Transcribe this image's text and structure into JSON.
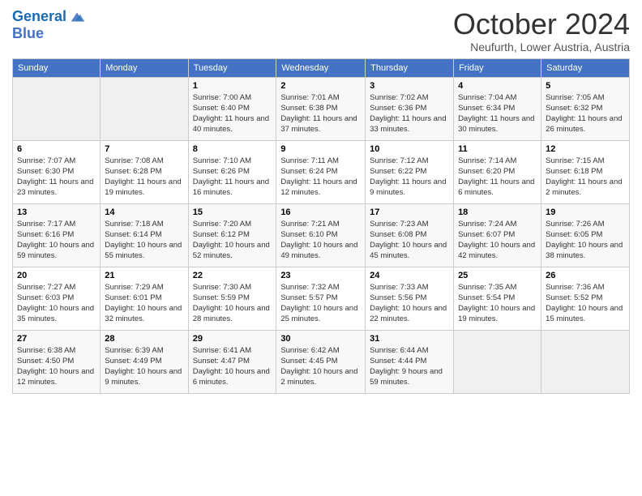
{
  "header": {
    "logo_line1": "General",
    "logo_line2": "Blue",
    "month": "October 2024",
    "location": "Neufurth, Lower Austria, Austria"
  },
  "weekdays": [
    "Sunday",
    "Monday",
    "Tuesday",
    "Wednesday",
    "Thursday",
    "Friday",
    "Saturday"
  ],
  "weeks": [
    [
      {
        "day": "",
        "info": ""
      },
      {
        "day": "",
        "info": ""
      },
      {
        "day": "1",
        "info": "Sunrise: 7:00 AM\nSunset: 6:40 PM\nDaylight: 11 hours and 40 minutes."
      },
      {
        "day": "2",
        "info": "Sunrise: 7:01 AM\nSunset: 6:38 PM\nDaylight: 11 hours and 37 minutes."
      },
      {
        "day": "3",
        "info": "Sunrise: 7:02 AM\nSunset: 6:36 PM\nDaylight: 11 hours and 33 minutes."
      },
      {
        "day": "4",
        "info": "Sunrise: 7:04 AM\nSunset: 6:34 PM\nDaylight: 11 hours and 30 minutes."
      },
      {
        "day": "5",
        "info": "Sunrise: 7:05 AM\nSunset: 6:32 PM\nDaylight: 11 hours and 26 minutes."
      }
    ],
    [
      {
        "day": "6",
        "info": "Sunrise: 7:07 AM\nSunset: 6:30 PM\nDaylight: 11 hours and 23 minutes."
      },
      {
        "day": "7",
        "info": "Sunrise: 7:08 AM\nSunset: 6:28 PM\nDaylight: 11 hours and 19 minutes."
      },
      {
        "day": "8",
        "info": "Sunrise: 7:10 AM\nSunset: 6:26 PM\nDaylight: 11 hours and 16 minutes."
      },
      {
        "day": "9",
        "info": "Sunrise: 7:11 AM\nSunset: 6:24 PM\nDaylight: 11 hours and 12 minutes."
      },
      {
        "day": "10",
        "info": "Sunrise: 7:12 AM\nSunset: 6:22 PM\nDaylight: 11 hours and 9 minutes."
      },
      {
        "day": "11",
        "info": "Sunrise: 7:14 AM\nSunset: 6:20 PM\nDaylight: 11 hours and 6 minutes."
      },
      {
        "day": "12",
        "info": "Sunrise: 7:15 AM\nSunset: 6:18 PM\nDaylight: 11 hours and 2 minutes."
      }
    ],
    [
      {
        "day": "13",
        "info": "Sunrise: 7:17 AM\nSunset: 6:16 PM\nDaylight: 10 hours and 59 minutes."
      },
      {
        "day": "14",
        "info": "Sunrise: 7:18 AM\nSunset: 6:14 PM\nDaylight: 10 hours and 55 minutes."
      },
      {
        "day": "15",
        "info": "Sunrise: 7:20 AM\nSunset: 6:12 PM\nDaylight: 10 hours and 52 minutes."
      },
      {
        "day": "16",
        "info": "Sunrise: 7:21 AM\nSunset: 6:10 PM\nDaylight: 10 hours and 49 minutes."
      },
      {
        "day": "17",
        "info": "Sunrise: 7:23 AM\nSunset: 6:08 PM\nDaylight: 10 hours and 45 minutes."
      },
      {
        "day": "18",
        "info": "Sunrise: 7:24 AM\nSunset: 6:07 PM\nDaylight: 10 hours and 42 minutes."
      },
      {
        "day": "19",
        "info": "Sunrise: 7:26 AM\nSunset: 6:05 PM\nDaylight: 10 hours and 38 minutes."
      }
    ],
    [
      {
        "day": "20",
        "info": "Sunrise: 7:27 AM\nSunset: 6:03 PM\nDaylight: 10 hours and 35 minutes."
      },
      {
        "day": "21",
        "info": "Sunrise: 7:29 AM\nSunset: 6:01 PM\nDaylight: 10 hours and 32 minutes."
      },
      {
        "day": "22",
        "info": "Sunrise: 7:30 AM\nSunset: 5:59 PM\nDaylight: 10 hours and 28 minutes."
      },
      {
        "day": "23",
        "info": "Sunrise: 7:32 AM\nSunset: 5:57 PM\nDaylight: 10 hours and 25 minutes."
      },
      {
        "day": "24",
        "info": "Sunrise: 7:33 AM\nSunset: 5:56 PM\nDaylight: 10 hours and 22 minutes."
      },
      {
        "day": "25",
        "info": "Sunrise: 7:35 AM\nSunset: 5:54 PM\nDaylight: 10 hours and 19 minutes."
      },
      {
        "day": "26",
        "info": "Sunrise: 7:36 AM\nSunset: 5:52 PM\nDaylight: 10 hours and 15 minutes."
      }
    ],
    [
      {
        "day": "27",
        "info": "Sunrise: 6:38 AM\nSunset: 4:50 PM\nDaylight: 10 hours and 12 minutes."
      },
      {
        "day": "28",
        "info": "Sunrise: 6:39 AM\nSunset: 4:49 PM\nDaylight: 10 hours and 9 minutes."
      },
      {
        "day": "29",
        "info": "Sunrise: 6:41 AM\nSunset: 4:47 PM\nDaylight: 10 hours and 6 minutes."
      },
      {
        "day": "30",
        "info": "Sunrise: 6:42 AM\nSunset: 4:45 PM\nDaylight: 10 hours and 2 minutes."
      },
      {
        "day": "31",
        "info": "Sunrise: 6:44 AM\nSunset: 4:44 PM\nDaylight: 9 hours and 59 minutes."
      },
      {
        "day": "",
        "info": ""
      },
      {
        "day": "",
        "info": ""
      }
    ]
  ]
}
